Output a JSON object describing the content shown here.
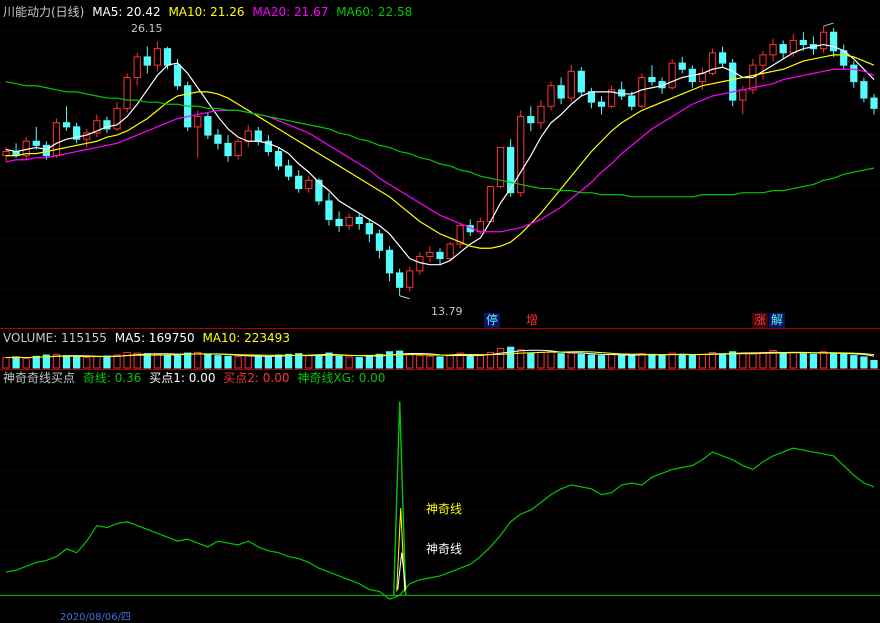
{
  "price_header": {
    "title": "川能动力(日线)",
    "ma5": "MA5: 20.42",
    "ma10": "MA10: 21.26",
    "ma20": "MA20: 21.67",
    "ma60": "MA60: 22.58"
  },
  "volume_header": {
    "title": "VOLUME: 115155",
    "ma5": "MA5: 169750",
    "ma10": "MA10: 223493"
  },
  "indicator_header": {
    "title": "神奇奇线买点",
    "qi": "奇线: 0.36",
    "buy1": "买点1: 0.00",
    "buy2": "买点2: 0.00",
    "xg": "神奇线XG: 0.00"
  },
  "price_high_label": "26.15",
  "price_low_label": "13.79",
  "event_tags": [
    "停",
    "增",
    "涨",
    "解"
  ],
  "indicator_labels": [
    "神奇线",
    "神奇线"
  ],
  "bottom_date_partial": "2020/08/06/四",
  "colors": {
    "up": "#ff3232",
    "down": "#54fcfc",
    "ma5": "#ffffff",
    "ma10": "#ffff00",
    "ma20": "#ff00ff",
    "ma60": "#00c800",
    "indicator": "#00c800"
  },
  "chart_data": [
    {
      "type": "candlestick",
      "title": "川能动力(日线)",
      "ylim": [
        13.0,
        27.0
      ],
      "candles": [
        [
          20.6,
          21.0,
          20.3,
          20.8
        ],
        [
          20.8,
          21.2,
          20.5,
          20.6
        ],
        [
          20.6,
          21.5,
          20.4,
          21.3
        ],
        [
          21.3,
          22.0,
          20.9,
          21.1
        ],
        [
          21.1,
          21.3,
          20.4,
          20.6
        ],
        [
          20.6,
          22.4,
          20.5,
          22.2
        ],
        [
          22.2,
          23.0,
          21.8,
          22.0
        ],
        [
          22.0,
          22.2,
          21.2,
          21.4
        ],
        [
          21.4,
          21.9,
          21.0,
          21.7
        ],
        [
          21.7,
          22.6,
          21.5,
          22.3
        ],
        [
          22.3,
          22.5,
          21.7,
          21.9
        ],
        [
          21.9,
          23.2,
          21.8,
          22.9
        ],
        [
          22.9,
          24.6,
          22.7,
          24.4
        ],
        [
          24.4,
          25.6,
          24.0,
          25.4
        ],
        [
          25.4,
          25.9,
          24.6,
          25.0
        ],
        [
          25.0,
          26.15,
          24.7,
          25.8
        ],
        [
          25.8,
          25.9,
          24.8,
          25.0
        ],
        [
          25.0,
          25.3,
          23.8,
          24.0
        ],
        [
          24.0,
          24.2,
          21.8,
          22.0
        ],
        [
          22.0,
          22.8,
          20.5,
          22.5
        ],
        [
          22.5,
          22.7,
          21.4,
          21.6
        ],
        [
          21.6,
          21.9,
          20.9,
          21.2
        ],
        [
          21.2,
          21.6,
          20.3,
          20.6
        ],
        [
          20.6,
          21.4,
          20.4,
          21.3
        ],
        [
          21.3,
          22.1,
          21.0,
          21.8
        ],
        [
          21.8,
          22.0,
          21.1,
          21.3
        ],
        [
          21.3,
          21.6,
          20.6,
          20.8
        ],
        [
          20.8,
          21.0,
          19.9,
          20.1
        ],
        [
          20.1,
          20.4,
          19.4,
          19.6
        ],
        [
          19.6,
          19.9,
          18.8,
          19.0
        ],
        [
          19.0,
          19.6,
          18.8,
          19.4
        ],
        [
          19.4,
          19.5,
          18.2,
          18.4
        ],
        [
          18.4,
          18.8,
          17.2,
          17.5
        ],
        [
          17.5,
          17.9,
          16.9,
          17.2
        ],
        [
          17.2,
          17.8,
          17.0,
          17.6
        ],
        [
          17.6,
          17.8,
          17.0,
          17.3
        ],
        [
          17.3,
          17.5,
          16.4,
          16.8
        ],
        [
          16.8,
          17.0,
          15.6,
          16.0
        ],
        [
          16.0,
          16.2,
          14.5,
          14.9
        ],
        [
          14.9,
          15.1,
          13.79,
          14.2
        ],
        [
          14.2,
          15.2,
          14.0,
          15.0
        ],
        [
          15.0,
          15.9,
          14.8,
          15.7
        ],
        [
          15.7,
          16.2,
          15.4,
          15.9
        ],
        [
          15.9,
          16.1,
          15.3,
          15.6
        ],
        [
          15.6,
          16.4,
          15.5,
          16.3
        ],
        [
          16.3,
          17.3,
          16.1,
          17.2
        ],
        [
          17.2,
          17.5,
          16.7,
          16.9
        ],
        [
          16.9,
          17.6,
          16.8,
          17.4
        ],
        [
          17.4,
          19.1,
          17.4,
          19.1
        ],
        [
          19.1,
          21.0,
          19.0,
          21.0
        ],
        [
          21.0,
          21.4,
          18.6,
          18.8
        ],
        [
          18.8,
          22.8,
          18.6,
          22.5
        ],
        [
          22.5,
          23.0,
          21.8,
          22.2
        ],
        [
          22.2,
          23.3,
          21.9,
          23.0
        ],
        [
          23.0,
          24.2,
          22.8,
          24.0
        ],
        [
          24.0,
          24.4,
          23.1,
          23.4
        ],
        [
          23.4,
          25.0,
          23.2,
          24.7
        ],
        [
          24.7,
          24.9,
          23.5,
          23.7
        ],
        [
          23.7,
          23.9,
          22.9,
          23.2
        ],
        [
          23.2,
          23.5,
          22.6,
          23.0
        ],
        [
          23.0,
          24.0,
          22.9,
          23.8
        ],
        [
          23.8,
          24.2,
          23.3,
          23.5
        ],
        [
          23.5,
          23.7,
          22.8,
          23.0
        ],
        [
          23.0,
          24.6,
          22.9,
          24.4
        ],
        [
          24.4,
          25.0,
          24.0,
          24.2
        ],
        [
          24.2,
          24.4,
          23.6,
          23.9
        ],
        [
          23.9,
          25.3,
          23.8,
          25.1
        ],
        [
          25.1,
          25.4,
          24.6,
          24.8
        ],
        [
          24.8,
          25.0,
          23.9,
          24.2
        ],
        [
          24.2,
          24.9,
          23.8,
          24.6
        ],
        [
          24.6,
          25.8,
          24.5,
          25.6
        ],
        [
          25.6,
          25.9,
          24.9,
          25.1
        ],
        [
          25.1,
          25.3,
          23.0,
          23.3
        ],
        [
          23.3,
          24.0,
          22.6,
          23.8
        ],
        [
          23.8,
          25.3,
          23.6,
          25.0
        ],
        [
          25.0,
          25.7,
          24.3,
          25.5
        ],
        [
          25.5,
          26.3,
          25.2,
          26.0
        ],
        [
          26.0,
          26.2,
          25.3,
          25.6
        ],
        [
          25.6,
          26.5,
          25.4,
          26.2
        ],
        [
          26.2,
          26.6,
          25.7,
          26.0
        ],
        [
          26.0,
          26.4,
          25.5,
          25.8
        ],
        [
          25.8,
          26.9,
          25.6,
          26.6
        ],
        [
          26.6,
          26.8,
          25.4,
          25.7
        ],
        [
          25.7,
          26.0,
          24.8,
          25.0
        ],
        [
          25.0,
          25.2,
          23.9,
          24.2
        ],
        [
          24.2,
          24.4,
          23.2,
          23.4
        ],
        [
          23.4,
          23.6,
          22.6,
          22.9
        ]
      ],
      "ma_series": [
        {
          "name": "MA5",
          "values": [
            20.9,
            20.8,
            20.9,
            21.0,
            20.9,
            21.2,
            21.4,
            21.5,
            21.6,
            21.8,
            22.0,
            22.1,
            22.5,
            23.1,
            23.8,
            24.5,
            25.0,
            25.1,
            24.6,
            23.9,
            23.2,
            22.5,
            21.9,
            21.5,
            21.3,
            21.3,
            21.2,
            21.0,
            20.7,
            20.2,
            19.8,
            19.3,
            18.9,
            18.4,
            18.1,
            17.8,
            17.5,
            17.2,
            16.8,
            16.2,
            15.6,
            15.4,
            15.3,
            15.3,
            15.5,
            15.9,
            16.3,
            16.6,
            17.4,
            18.3,
            19.0,
            19.8,
            20.6,
            21.5,
            22.2,
            22.6,
            23.1,
            23.5,
            23.7,
            23.7,
            23.7,
            23.6,
            23.6,
            23.8,
            23.9,
            24.0,
            24.2,
            24.4,
            24.5,
            24.6,
            24.8,
            24.9,
            24.7,
            24.4,
            24.4,
            24.7,
            25.0,
            25.3,
            25.6,
            25.8,
            25.9,
            26.0,
            25.9,
            25.7,
            25.3,
            24.8,
            24.3
          ]
        },
        {
          "name": "MA10",
          "values": [
            20.6,
            20.6,
            20.7,
            20.7,
            20.8,
            20.9,
            21.0,
            21.1,
            21.2,
            21.3,
            21.5,
            21.6,
            21.8,
            22.1,
            22.4,
            22.8,
            23.2,
            23.5,
            23.6,
            23.7,
            23.7,
            23.6,
            23.4,
            23.1,
            22.8,
            22.5,
            22.2,
            21.9,
            21.6,
            21.3,
            21.0,
            20.7,
            20.4,
            20.1,
            19.8,
            19.5,
            19.2,
            18.9,
            18.6,
            18.2,
            17.8,
            17.4,
            17.1,
            16.8,
            16.6,
            16.4,
            16.2,
            16.1,
            16.1,
            16.2,
            16.4,
            16.8,
            17.3,
            17.8,
            18.4,
            19.0,
            19.6,
            20.2,
            20.8,
            21.3,
            21.8,
            22.2,
            22.5,
            22.8,
            23.0,
            23.2,
            23.4,
            23.6,
            23.8,
            24.0,
            24.1,
            24.2,
            24.3,
            24.4,
            24.5,
            24.6,
            24.7,
            24.8,
            25.0,
            25.2,
            25.3,
            25.4,
            25.5,
            25.5,
            25.4,
            25.2,
            25.0
          ]
        },
        {
          "name": "MA20",
          "values": [
            20.3,
            20.4,
            20.4,
            20.5,
            20.5,
            20.6,
            20.7,
            20.8,
            20.9,
            21.0,
            21.1,
            21.2,
            21.4,
            21.6,
            21.8,
            22.0,
            22.2,
            22.4,
            22.5,
            22.6,
            22.7,
            22.8,
            22.8,
            22.8,
            22.7,
            22.6,
            22.5,
            22.3,
            22.1,
            21.9,
            21.7,
            21.4,
            21.1,
            20.8,
            20.5,
            20.2,
            19.9,
            19.5,
            19.2,
            18.9,
            18.6,
            18.3,
            18.0,
            17.7,
            17.5,
            17.3,
            17.1,
            16.9,
            16.9,
            16.9,
            17.0,
            17.1,
            17.3,
            17.5,
            17.8,
            18.1,
            18.5,
            18.9,
            19.3,
            19.8,
            20.2,
            20.7,
            21.1,
            21.5,
            21.9,
            22.2,
            22.5,
            22.8,
            23.1,
            23.3,
            23.5,
            23.6,
            23.7,
            23.8,
            23.9,
            24.0,
            24.1,
            24.3,
            24.4,
            24.5,
            24.6,
            24.7,
            24.8,
            24.8,
            24.8,
            24.7,
            24.5
          ]
        },
        {
          "name": "MA60",
          "values": [
            24.2,
            24.1,
            24.0,
            24.0,
            23.9,
            23.8,
            23.7,
            23.7,
            23.6,
            23.5,
            23.4,
            23.4,
            23.3,
            23.3,
            23.2,
            23.2,
            23.1,
            23.1,
            23.0,
            23.0,
            22.9,
            22.9,
            22.8,
            22.8,
            22.7,
            22.6,
            22.5,
            22.4,
            22.3,
            22.2,
            22.1,
            22.0,
            21.9,
            21.7,
            21.6,
            21.4,
            21.3,
            21.1,
            21.0,
            20.8,
            20.7,
            20.5,
            20.4,
            20.2,
            20.1,
            19.9,
            19.8,
            19.6,
            19.5,
            19.4,
            19.3,
            19.2,
            19.1,
            19.0,
            19.0,
            18.9,
            18.9,
            18.8,
            18.8,
            18.7,
            18.7,
            18.7,
            18.6,
            18.6,
            18.6,
            18.6,
            18.6,
            18.6,
            18.6,
            18.7,
            18.7,
            18.7,
            18.7,
            18.8,
            18.8,
            18.8,
            18.9,
            18.9,
            19.0,
            19.1,
            19.2,
            19.4,
            19.5,
            19.7,
            19.8,
            19.9,
            20.0
          ]
        }
      ]
    },
    {
      "type": "bar",
      "title": "VOLUME: 115155",
      "ylim": [
        0,
        400000
      ],
      "values": [
        160000,
        170000,
        150000,
        180000,
        200000,
        210000,
        190000,
        170000,
        160000,
        175000,
        185000,
        200000,
        240000,
        230000,
        220000,
        210000,
        200000,
        210000,
        230000,
        240000,
        200000,
        190000,
        180000,
        175000,
        190000,
        180000,
        170000,
        200000,
        210000,
        220000,
        190000,
        200000,
        230000,
        180000,
        170000,
        160000,
        190000,
        210000,
        250000,
        260000,
        210000,
        190000,
        180000,
        170000,
        200000,
        230000,
        180000,
        190000,
        240000,
        300000,
        320000,
        280000,
        230000,
        240000,
        250000,
        220000,
        230000,
        210000,
        200000,
        190000,
        210000,
        200000,
        190000,
        220000,
        210000,
        190000,
        230000,
        210000,
        200000,
        210000,
        240000,
        220000,
        250000,
        230000,
        220000,
        240000,
        270000,
        230000,
        240000,
        220000,
        210000,
        250000,
        230000,
        210000,
        190000,
        170000,
        115155
      ]
    },
    {
      "type": "line",
      "title": "神奇奇线买点",
      "ylim": [
        -0.05,
        1.05
      ],
      "series": [
        {
          "name": "奇线",
          "values": [
            0.12,
            0.13,
            0.15,
            0.17,
            0.18,
            0.2,
            0.24,
            0.22,
            0.28,
            0.36,
            0.35,
            0.37,
            0.38,
            0.36,
            0.34,
            0.32,
            0.3,
            0.28,
            0.29,
            0.27,
            0.25,
            0.28,
            0.27,
            0.26,
            0.28,
            0.25,
            0.23,
            0.22,
            0.2,
            0.19,
            0.17,
            0.14,
            0.12,
            0.1,
            0.08,
            0.06,
            0.03,
            0.02,
            -0.02,
            0.0,
            0.06,
            0.08,
            0.09,
            0.1,
            0.12,
            0.14,
            0.16,
            0.2,
            0.25,
            0.31,
            0.38,
            0.42,
            0.44,
            0.48,
            0.52,
            0.55,
            0.57,
            0.56,
            0.55,
            0.52,
            0.53,
            0.57,
            0.58,
            0.57,
            0.61,
            0.63,
            0.65,
            0.66,
            0.67,
            0.7,
            0.74,
            0.72,
            0.7,
            0.67,
            0.65,
            0.69,
            0.72,
            0.74,
            0.76,
            0.75,
            0.74,
            0.73,
            0.72,
            0.67,
            0.62,
            0.58,
            0.56
          ]
        }
      ],
      "spike": {
        "x_index": 40,
        "value": 1.0
      }
    }
  ]
}
